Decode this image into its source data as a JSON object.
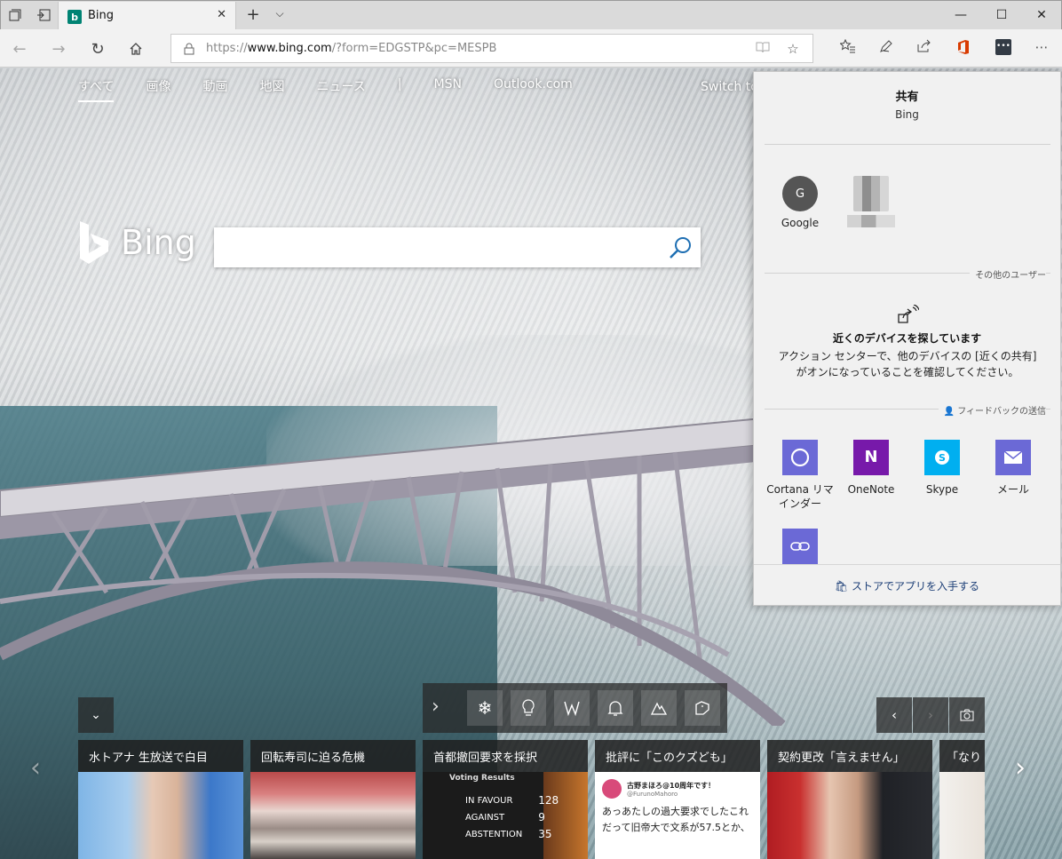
{
  "browser": {
    "tab_title": "Bing",
    "tab_favicon": "b",
    "url_scheme": "https://",
    "url_host": "www.bing.com",
    "url_path": "/?form=EDGSTP&pc=MESPB"
  },
  "bing": {
    "nav": [
      "すべて",
      "画像",
      "動画",
      "地図",
      "ニュース",
      "|",
      "MSN",
      "Outlook.com"
    ],
    "switch_label": "Switch to",
    "logo_text": "Bing",
    "search_value": ""
  },
  "news": [
    {
      "headline": "水トアナ 生放送で白目"
    },
    {
      "headline": "回転寿司に迫る危機"
    },
    {
      "headline": "首都撤回要求を採択"
    },
    {
      "headline": "批評に「このクズども」"
    },
    {
      "headline": "契約更改「言えません」"
    },
    {
      "headline": "「なり"
    }
  ],
  "vote_card": {
    "title": "Voting Results",
    "rows": [
      {
        "label": "IN FAVOUR",
        "value": "128"
      },
      {
        "label": "AGAINST",
        "value": "9"
      },
      {
        "label": "ABSTENTION",
        "value": "35"
      }
    ]
  },
  "tweet_card": {
    "user": "古野まほろ@10周年です！",
    "handle": "@FurunoMahoro",
    "line1": "あっあたしの過大要求でしたこれ",
    "line2": "だって旧帝大で文系が57.5とか、"
  },
  "share_panel": {
    "title": "共有",
    "subtitle": "Bing",
    "contacts": [
      {
        "initial": "G",
        "name": "Google"
      }
    ],
    "other_users_label": "その他のユーザー",
    "nearby_title": "近くのデバイスを探しています",
    "nearby_desc": "アクション センターで、他のデバイスの [近くの共有] がオンになっていることを確認してください。",
    "feedback_label": "フィードバックの送信",
    "apps": [
      {
        "name": "Cortana リマインダー",
        "color": "#6b69d6"
      },
      {
        "name": "OneNote",
        "color": "#7719aa"
      },
      {
        "name": "Skype",
        "color": "#00aff0"
      },
      {
        "name": "メール",
        "color": "#6b69d6"
      },
      {
        "name": "",
        "color": "#6b69d6"
      }
    ],
    "store_link": "ストアでアプリを入手する"
  }
}
